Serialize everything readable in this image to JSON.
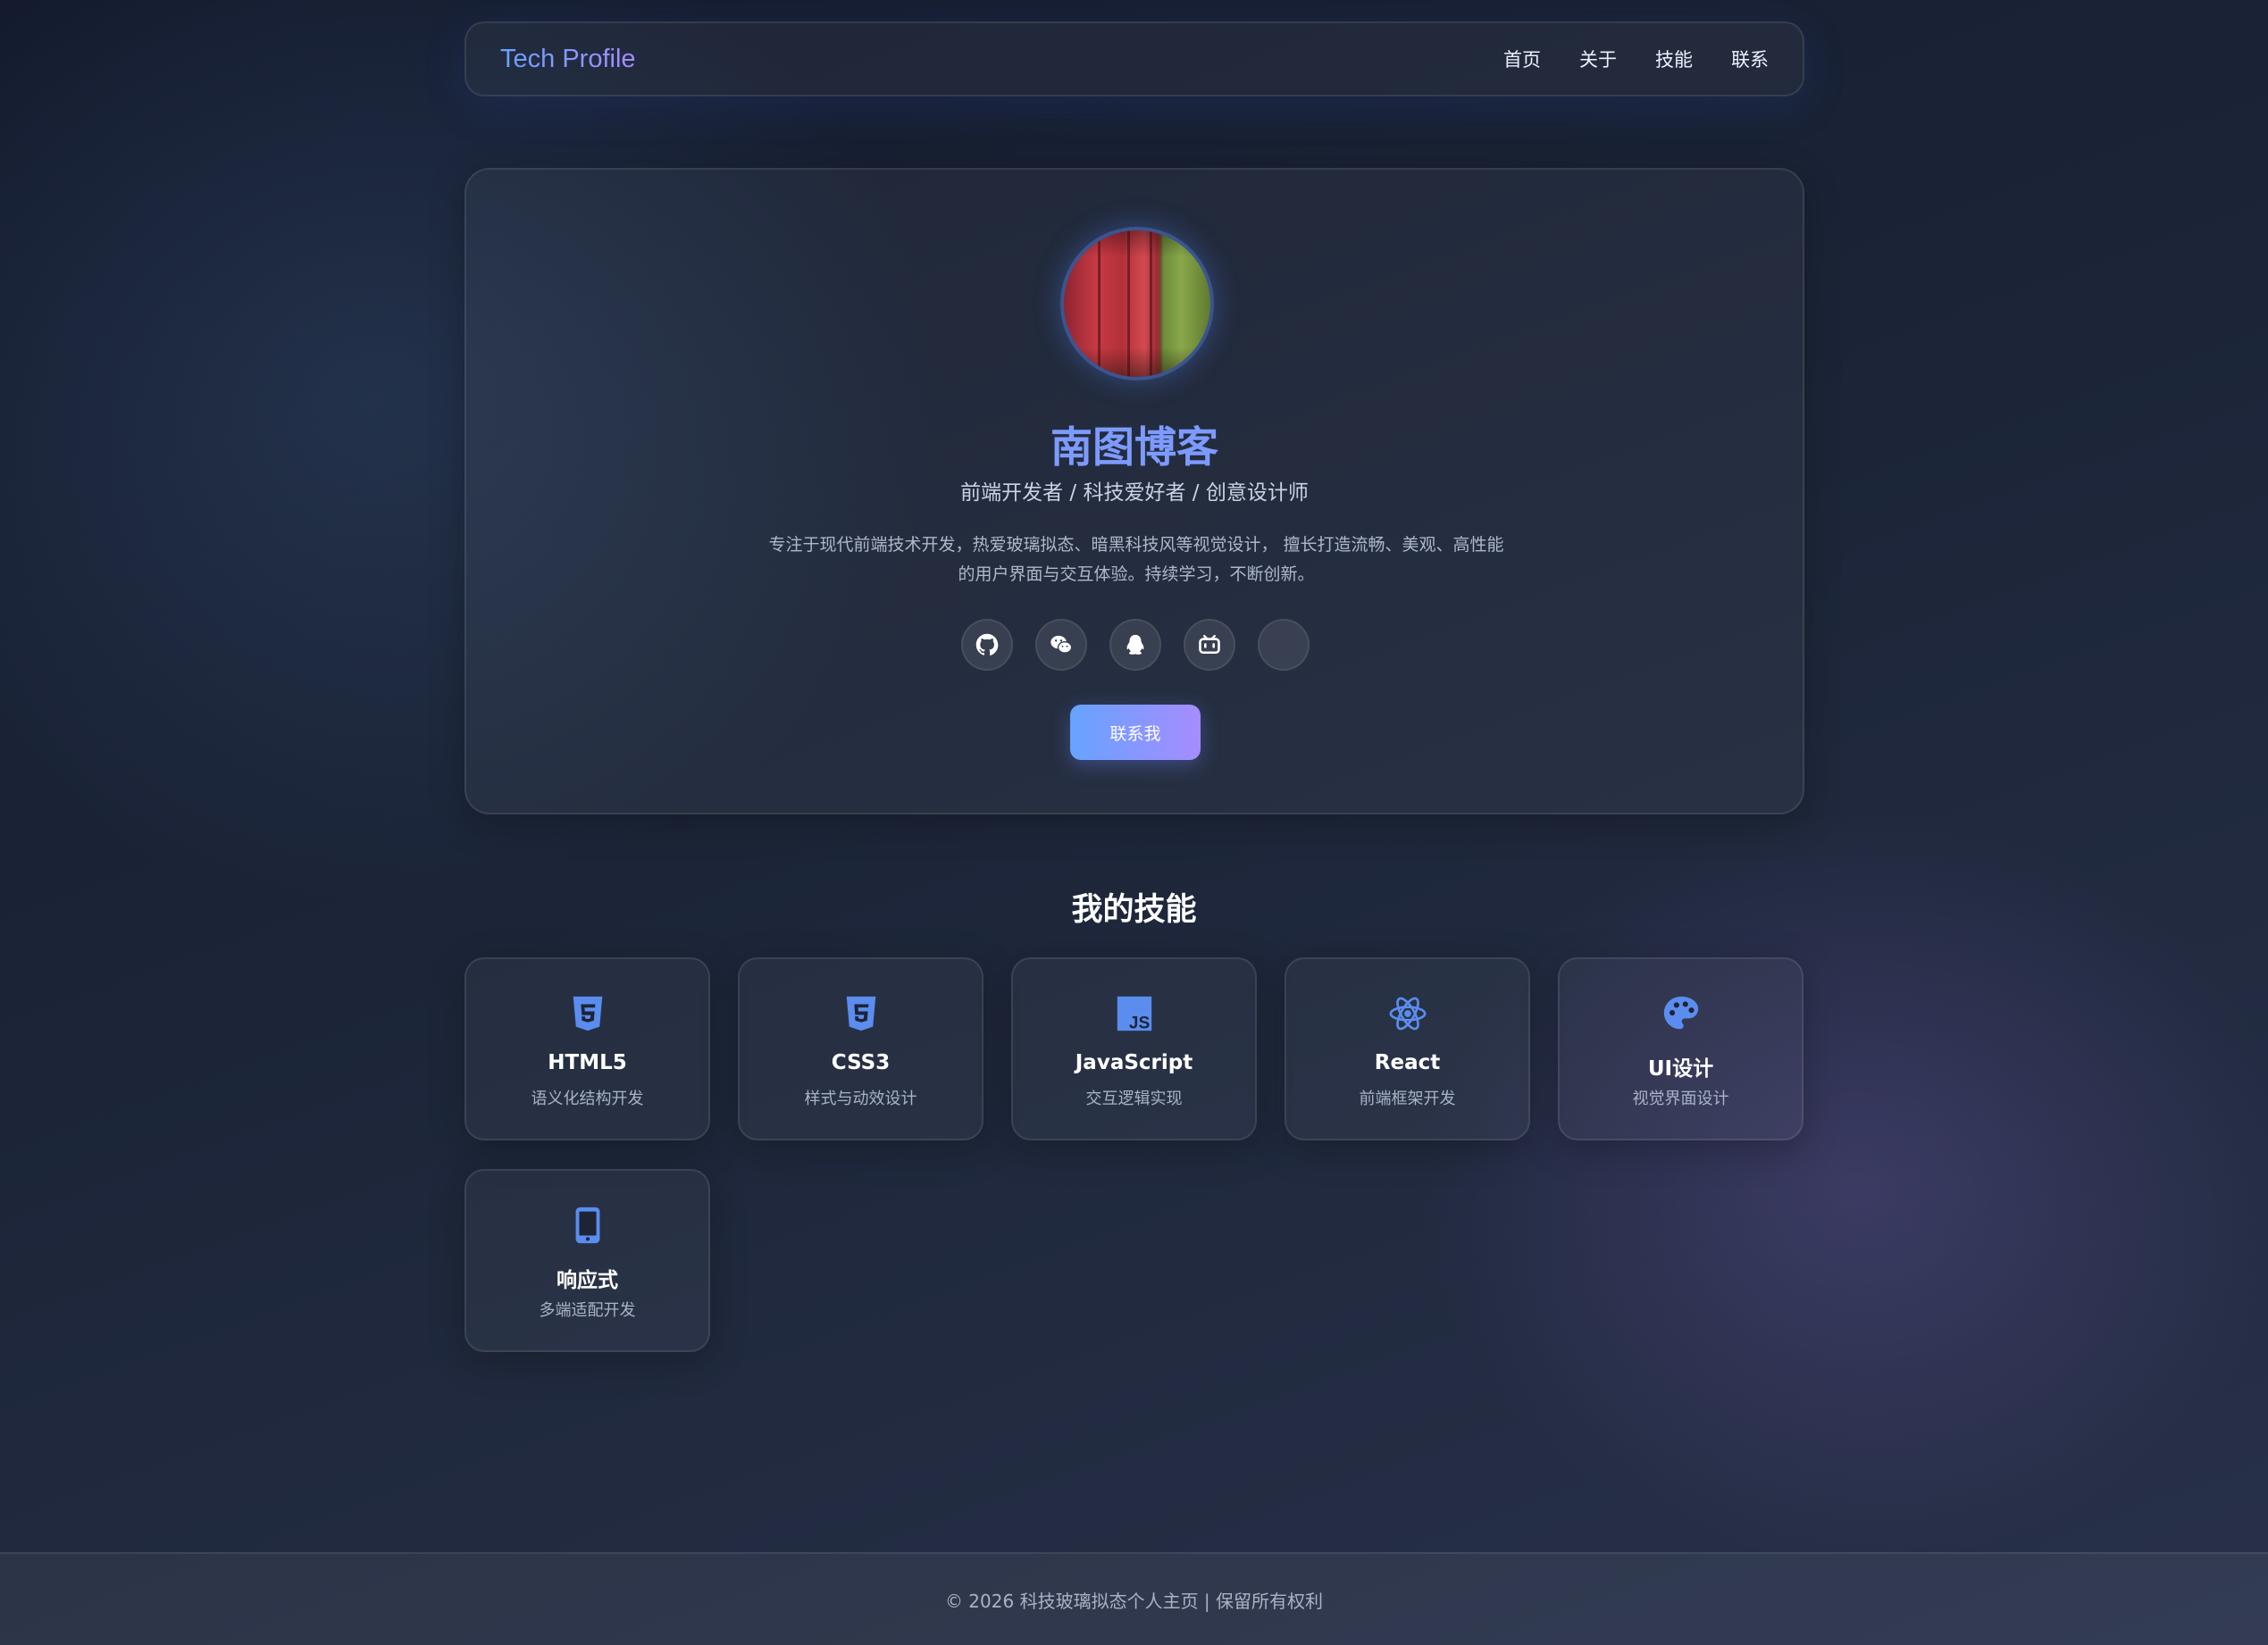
{
  "nav": {
    "brand": "Tech Profile",
    "links": [
      "首页",
      "关于",
      "技能",
      "联系"
    ]
  },
  "hero": {
    "name": "南图博客",
    "subtitle": "前端开发者 / 科技爱好者 / 创意设计师",
    "description_line1": "专注于现代前端技术开发，热爱玻璃拟态、暗黑科技风等视觉设计， 擅长打造流畅、美观、高性能",
    "description_line2": "的用户界面与交互体验。持续学习，不断创新。",
    "socials": [
      "github-icon",
      "wechat-icon",
      "qq-icon",
      "bilibili-icon",
      "blank-icon"
    ],
    "contact_button": "联系我"
  },
  "skills": {
    "title": "我的技能",
    "items": [
      {
        "icon": "html5-icon",
        "name": "HTML5",
        "desc": "语义化结构开发"
      },
      {
        "icon": "css3-icon",
        "name": "CSS3",
        "desc": "样式与动效设计"
      },
      {
        "icon": "javascript-icon",
        "name": "JavaScript",
        "desc": "交互逻辑实现"
      },
      {
        "icon": "react-icon",
        "name": "React",
        "desc": "前端框架开发"
      },
      {
        "icon": "palette-icon",
        "name": "UI设计",
        "desc": "视觉界面设计"
      },
      {
        "icon": "mobile-icon",
        "name": "响应式",
        "desc": "多端适配开发"
      }
    ]
  },
  "footer": {
    "text": "© 2026 科技玻璃拟态个人主页 | 保留所有权利"
  },
  "colors": {
    "accent_start": "#66a3ff",
    "accent_end": "#a68cff",
    "skill_icon": "#5b8def",
    "name": "#7d9bff"
  }
}
